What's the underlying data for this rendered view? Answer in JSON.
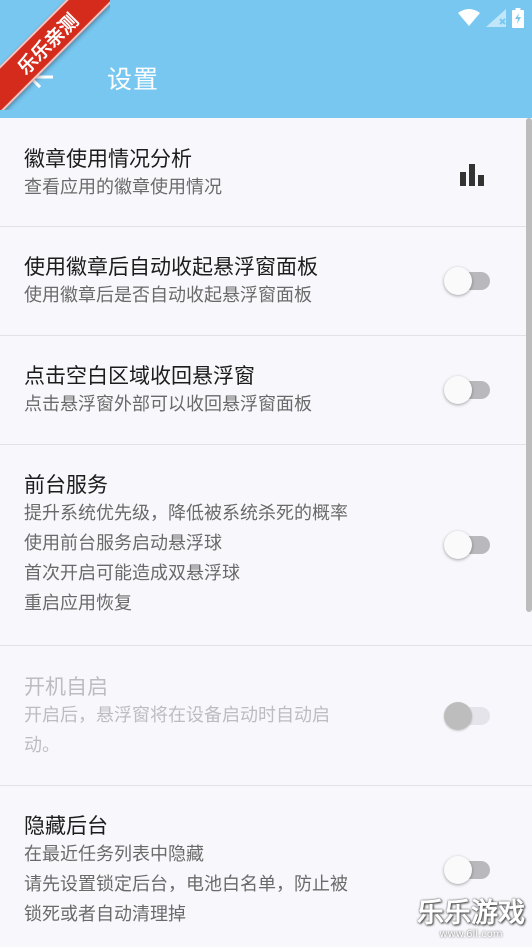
{
  "status_bar": {
    "icons": [
      "wifi-icon",
      "cell-signal-icon",
      "battery-icon"
    ]
  },
  "app_bar": {
    "title": "设置",
    "background": "#77c7f1"
  },
  "ribbon": {
    "text": "乐乐亲测",
    "color": "#d42b1d"
  },
  "settings": [
    {
      "title": "徽章使用情况分析",
      "subtitle": [
        "查看应用的徽章使用情况"
      ],
      "control": "chart-icon"
    },
    {
      "title": "使用徽章后自动收起悬浮窗面板",
      "subtitle": [
        "使用徽章后是否自动收起悬浮窗面板"
      ],
      "control": "switch",
      "on": false
    },
    {
      "title": "点击空白区域收回悬浮窗",
      "subtitle": [
        "点击悬浮窗外部可以收回悬浮窗面板"
      ],
      "control": "switch",
      "on": false
    },
    {
      "title": "前台服务",
      "subtitle": [
        "提升系统优先级，降低被系统杀死的概率",
        "使用前台服务启动悬浮球",
        "首次开启可能造成双悬浮球",
        "重启应用恢复"
      ],
      "control": "switch",
      "on": false
    },
    {
      "title": "开机自启",
      "subtitle": [
        "开启后，悬浮窗将在设备启动时自动启",
        "动。"
      ],
      "control": "switch",
      "on": false,
      "enabled": false
    },
    {
      "title": "隐藏后台",
      "subtitle": [
        "在最近任务列表中隐藏",
        "请先设置锁定后台，电池白名单，防止被",
        "锁死或者自动清理掉"
      ],
      "control": "switch",
      "on": false
    }
  ],
  "watermark": {
    "text": "乐乐游戏",
    "url": "www.6ll.com"
  }
}
